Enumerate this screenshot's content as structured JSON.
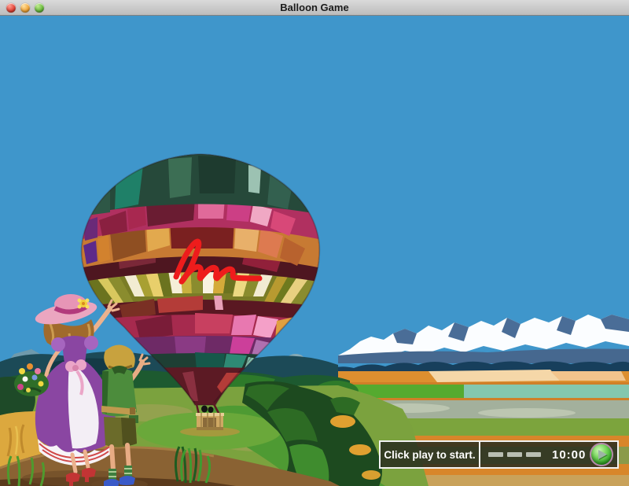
{
  "window": {
    "title": "Balloon Game",
    "traffic_lights": [
      {
        "name": "close",
        "color": "#e2463a"
      },
      {
        "name": "minimize",
        "color": "#f0a63c"
      },
      {
        "name": "zoom",
        "color": "#6cbb3f"
      }
    ]
  },
  "control_bar": {
    "message": "Click play to start.",
    "timer": "10:00",
    "progress_dashes": 3,
    "colors": {
      "background": "rgba(40,43,30,0.85)",
      "border": "#f2f2f2",
      "dash": "#b9beb2",
      "text": "#ffffff",
      "play_ring": "#b588aa",
      "play_green": "#35ae27",
      "play_triangle": "#9db4a6"
    }
  },
  "scene": {
    "balloon_logo": "hm",
    "colors": {
      "sky": "#3f96cb",
      "snow": "#fbfdff",
      "mountain_rock": "#4a6d97",
      "distant_hills": "#1c4a57",
      "treeline_navy": "#173f5c",
      "treeline_green": "#1d5a30",
      "meadow": "#7ba23e",
      "bright_grass": "#4e9a33",
      "dark_bush": "#1d4a1f",
      "wheat": "#dca83e",
      "dirt": "#8a6233",
      "field_orange": "#dd8f2f",
      "field_teal": "#84c7ae",
      "field_green": "#55aa2f",
      "balloon_crown": "#26493a",
      "balloon_cone": "#5c1a24",
      "balloon_stripe_cream": "#f2ecd2",
      "logo_red": "#ee1c1c",
      "basket": "#cfa964"
    }
  }
}
